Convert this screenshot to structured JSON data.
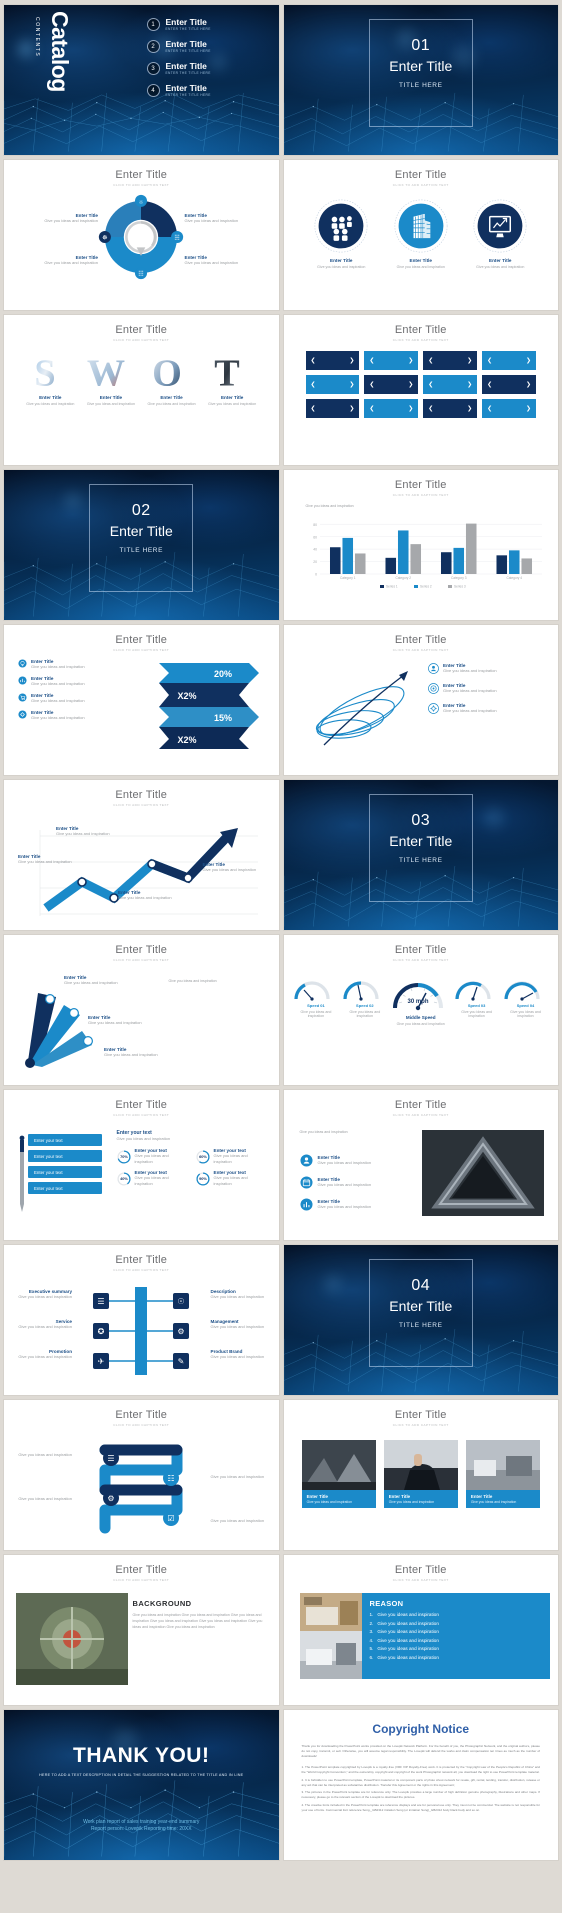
{
  "theme": {
    "navy": "#10305f",
    "blue": "#1b8ac9",
    "light_blue": "#4aa8d8",
    "dark_bg": "#05203f",
    "title_gray": "#6d6e71"
  },
  "common": {
    "enter_title": "Enter Title",
    "caption_hint": "CLICK TO ADD CAPTION TEXT",
    "give_ideas": "Give you ideas and inspiration",
    "enter_text": "Enter your text",
    "title_here": "TITLE HERE"
  },
  "cover": {
    "brand": "Catalog",
    "brand_sub": "CONTENTS",
    "toc": [
      {
        "num": "1",
        "title": "Enter Title",
        "sub": "ENTER THE TITLE HERE"
      },
      {
        "num": "2",
        "title": "Enter Title",
        "sub": "ENTER THE TITLE HERE"
      },
      {
        "num": "3",
        "title": "Enter Title",
        "sub": "ENTER THE TITLE HERE"
      },
      {
        "num": "4",
        "title": "Enter Title",
        "sub": "ENTER THE TITLE HERE"
      }
    ]
  },
  "sections": [
    {
      "num": "01",
      "title": "Enter Title",
      "sub": "TITLE HERE"
    },
    {
      "num": "02",
      "title": "Enter Title",
      "sub": "TITLE HERE"
    },
    {
      "num": "03",
      "title": "Enter Title",
      "sub": "TITLE HERE"
    },
    {
      "num": "04",
      "title": "Enter Title",
      "sub": "TITLE HERE"
    }
  ],
  "slide_cycle": {
    "title": "Enter Title",
    "caption": "CLICK TO ADD CAPTION TEXT",
    "labels": [
      {
        "title": "Enter Title",
        "desc": "Give you ideas and inspiration"
      },
      {
        "title": "Enter Title",
        "desc": "Give you ideas and inspiration"
      },
      {
        "title": "Enter Title",
        "desc": "Give you ideas and inspiration"
      },
      {
        "title": "Enter Title",
        "desc": "Give you ideas and inspiration"
      }
    ]
  },
  "slide_circles": {
    "title": "Enter Title",
    "caption": "CLICK TO ADD CAPTION TEXT",
    "items": [
      {
        "icon": "team-icon",
        "title": "Enter Title",
        "desc": "Give you ideas and inspiration",
        "color": "#10305f"
      },
      {
        "icon": "building-icon",
        "title": "Enter Title",
        "desc": "Give you ideas and inspiration",
        "color": "#1b8ac9"
      },
      {
        "icon": "monitor-icon",
        "title": "Enter Title",
        "desc": "Give you ideas and inspiration",
        "color": "#10305f"
      }
    ]
  },
  "slide_swot": {
    "title": "Enter Title",
    "caption": "CLICK TO ADD CAPTION TEXT",
    "letters": [
      "S",
      "W",
      "O",
      "T"
    ],
    "items": [
      {
        "title": "Enter Title",
        "desc": "Give you ideas and inspiration"
      },
      {
        "title": "Enter Title",
        "desc": "Give you ideas and inspiration"
      },
      {
        "title": "Enter Title",
        "desc": "Give you ideas and inspiration"
      },
      {
        "title": "Enter Title",
        "desc": "Give you ideas and inspiration"
      }
    ]
  },
  "slide_grid": {
    "title": "Enter Title",
    "caption": "CLICK TO ADD CAPTION TEXT",
    "rows": [
      [
        "#10305f",
        "#1b8ac9",
        "#10305f",
        "#1b8ac9"
      ],
      [
        "#1b8ac9",
        "#10305f",
        "#1b8ac9",
        "#10305f"
      ],
      [
        "#10305f",
        "#1b8ac9",
        "#10305f",
        "#1b8ac9"
      ]
    ],
    "left_mark": "❮",
    "right_mark": "❯"
  },
  "slide_chart": {
    "title": "Enter Title",
    "caption": "CLICK TO ADD CAPTION TEXT",
    "note": "Give you ideas and inspiration",
    "chart_data": {
      "type": "bar",
      "title": "",
      "xlabel": "",
      "ylabel": "",
      "categories": [
        "Category 1",
        "Category 2",
        "Category 3",
        "Category 4"
      ],
      "series": [
        {
          "name": "Series 1",
          "color": "#10305f",
          "values": [
            43,
            26,
            35,
            30
          ]
        },
        {
          "name": "Series 2",
          "color": "#1b8ac9",
          "values": [
            58,
            70,
            42,
            38
          ]
        },
        {
          "name": "Series 3",
          "color": "#a6a8ab",
          "values": [
            33,
            48,
            81,
            25
          ]
        }
      ],
      "ylim": [
        0,
        90
      ],
      "yticks": [
        0,
        20,
        40,
        60,
        80
      ],
      "grid": true,
      "legend_position": "bottom"
    }
  },
  "slide_zigzag": {
    "title": "Enter Title",
    "caption": "CLICK TO ADD CAPTION TEXT",
    "left_items": [
      {
        "title": "Enter Title",
        "desc": "Give you ideas and inspiration"
      },
      {
        "title": "Enter Title",
        "desc": "Give you ideas and inspiration"
      },
      {
        "title": "Enter Title",
        "desc": "Give you ideas and inspiration"
      },
      {
        "title": "Enter Title",
        "desc": "Give you ideas and inspiration"
      }
    ],
    "percents": [
      "20%",
      "X2%",
      "15%",
      "X2%"
    ]
  },
  "slide_orbit": {
    "title": "Enter Title",
    "caption": "CLICK TO ADD CAPTION TEXT",
    "items": [
      {
        "title": "Enter Title",
        "desc": "Give you ideas and inspiration"
      },
      {
        "title": "Enter Title",
        "desc": "Give you ideas and inspiration"
      },
      {
        "title": "Enter Title",
        "desc": "Give you ideas and inspiration"
      }
    ]
  },
  "slide_growth": {
    "title": "Enter Title",
    "caption": "CLICK TO ADD CAPTION TEXT",
    "nodes": [
      {
        "title": "Enter Title",
        "desc": "Give you ideas and inspiration"
      },
      {
        "title": "Enter Title",
        "desc": "Give you ideas and inspiration"
      },
      {
        "title": "Enter Title",
        "desc": "Give you ideas and inspiration"
      },
      {
        "title": "Enter Title",
        "desc": "Give you ideas and inspiration"
      }
    ]
  },
  "slide_fan": {
    "title": "Enter Title",
    "caption": "CLICK TO ADD CAPTION TEXT",
    "items": [
      {
        "title": "Enter Title",
        "desc": "Give you ideas and inspiration"
      },
      {
        "title": "Enter Title",
        "desc": "Give you ideas and inspiration"
      },
      {
        "title": "Enter Title",
        "desc": "Give you ideas and inspiration"
      }
    ]
  },
  "slide_gauges": {
    "title": "Enter Title",
    "caption": "CLICK TO ADD CAPTION TEXT",
    "center_value": "30 mph",
    "center_label": "Middle Speed",
    "center_desc": "Give you ideas and inspiration",
    "gauges": [
      {
        "label": "Speed 01",
        "desc": "Give you ideas and inspiration"
      },
      {
        "label": "Speed 02",
        "desc": "Give you ideas and inspiration"
      },
      {
        "label": "Speed 03",
        "desc": "Give you ideas and inspiration"
      },
      {
        "label": "Speed 04",
        "desc": "Give you ideas and inspiration"
      }
    ]
  },
  "slide_pen": {
    "title": "Enter Title",
    "caption": "CLICK TO ADD CAPTION TEXT",
    "bars": [
      "Enter your text",
      "Enter your text",
      "Enter your text",
      "Enter your text"
    ],
    "stats": [
      {
        "pct": "70%",
        "label": "Enter your text",
        "desc": "Give you ideas and inspiration"
      },
      {
        "pct": "60%",
        "label": "Enter your text",
        "desc": "Give you ideas and inspiration"
      },
      {
        "pct": "40%",
        "label": "Enter your text",
        "desc": "Give you ideas and inspiration"
      },
      {
        "pct": "90%",
        "label": "Enter your text",
        "desc": "Give you ideas and inspiration"
      }
    ],
    "heading": "Enter your text",
    "heading_desc": "Give you ideas and inspiration"
  },
  "slide_photo_list": {
    "title": "Enter Title",
    "caption": "CLICK TO ADD CAPTION TEXT",
    "intro": "Give you ideas and inspiration",
    "items": [
      {
        "icon": "user-icon",
        "title": "Enter Title",
        "desc": "Give you ideas and inspiration"
      },
      {
        "icon": "calendar-icon",
        "title": "Enter Title",
        "desc": "Give you ideas and inspiration"
      },
      {
        "icon": "chart-icon",
        "title": "Enter Title",
        "desc": "Give you ideas and inspiration"
      }
    ]
  },
  "slide_tree": {
    "title": "Enter Title",
    "caption": "CLICK TO ADD CAPTION TEXT",
    "left": [
      {
        "label": "Executive summary",
        "desc": "Give you ideas and inspiration"
      },
      {
        "label": "Service",
        "desc": "Give you ideas and inspiration"
      },
      {
        "label": "Promotion",
        "desc": "Give you ideas and inspiration"
      }
    ],
    "right": [
      {
        "label": "Description",
        "desc": "Give you ideas and inspiration"
      },
      {
        "label": "Management",
        "desc": "Give you ideas and inspiration"
      },
      {
        "label": "Product Brand",
        "desc": "Give you ideas and inspiration"
      }
    ]
  },
  "slide_snake": {
    "title": "Enter Title",
    "caption": "CLICK TO ADD CAPTION TEXT",
    "items": [
      {
        "desc": "Give you ideas and inspiration"
      },
      {
        "desc": "Give you ideas and inspiration"
      },
      {
        "desc": "Give you ideas and inspiration"
      },
      {
        "desc": "Give you ideas and inspiration"
      }
    ]
  },
  "slide_three_photos": {
    "title": "Enter Title",
    "caption": "CLICK TO ADD CAPTION TEXT",
    "cards": [
      {
        "title": "Enter Title",
        "desc": "Give you ideas and inspiration"
      },
      {
        "title": "Enter Title",
        "desc": "Give you ideas and inspiration"
      },
      {
        "title": "Enter Title",
        "desc": "Give you ideas and inspiration"
      }
    ]
  },
  "slide_background": {
    "title": "Enter Title",
    "caption": "CLICK TO ADD CAPTION TEXT",
    "heading": "BACKGROUND",
    "body": "Give you ideas and inspiration  Give you ideas and inspiration Give you ideas and inspiration Give you ideas and inspiration Give you ideas and inspiration Give you ideas and inspiration Give you ideas and inspiration"
  },
  "slide_reason": {
    "title": "Enter Title",
    "caption": "CLICK TO ADD CAPTION TEXT",
    "heading": "REASON",
    "items": [
      {
        "n": "1.",
        "text": "Give you ideas and inspiration"
      },
      {
        "n": "2.",
        "text": "Give you ideas and inspiration"
      },
      {
        "n": "3.",
        "text": "Give you ideas and inspiration"
      },
      {
        "n": "4.",
        "text": "Give you ideas and inspiration"
      },
      {
        "n": "5.",
        "text": "Give you ideas and inspiration"
      },
      {
        "n": "6.",
        "text": "Give you ideas and inspiration"
      }
    ]
  },
  "slide_thanks": {
    "headline": "THANK YOU!",
    "subline": "HERE TO ADD A TEXT DESCRIPTION IN DETAIL THE SUGGESTION RELATED TO THE TITLE AND IN LINE",
    "footer_line1": "Work plan report of sales training year-end summary",
    "footer_line2": "Report person:  Lovepik        Reporting time:  20XX"
  },
  "slide_copyright": {
    "title": "Copyright Notice",
    "intro": "Thank you for downloading the PowerPoint works provided on the Lovepik Network Platform. For the benefit of you, the Photographic Network, and the original authors, please do not copy, transmit, or sell. Otherwise, you will assume legal responsibility. The Lovepik will defend the works and claim compensation ten times as much as the number of downloads!",
    "paragraphs": [
      "1. The PowerPoint template copyrighted by Lovepik is a royalty-free (VRF VIP Royalty-Free) work. It is protected by the \"Copyright Law of the People's Republic of China\" and the \"World Copyright Convention,\" and the ownership, copyright and copyright of the work Photographic network all, you download the right to use PowerPoint template material.",
      "2. It is forbidden to use PowerPoint template, PowerPoint material or its component parts of photo shoot network for resale, gift, rental, lending, transfer, distribution, release or any act that can be interpreted as substantive distribution. Transfer this Agreement or the rights in this Agreement;",
      "3. The pictures in the PowerPoint template are for reference only. The Lovepik provides a large number of high definition genuine photography, illustrations and other maps. If necessary, please go to the relevant section of the Lovepik to download the pictures.",
      "4. The creative fonts included in the PowerPoint template are reference displays and are for personal use only. They must not be commercial. The website is not responsible for your use of fonts. Commercial font reference Song,_GB2312 imitation Song (or imitation Song)_GB2312 body black body and so on."
    ]
  }
}
